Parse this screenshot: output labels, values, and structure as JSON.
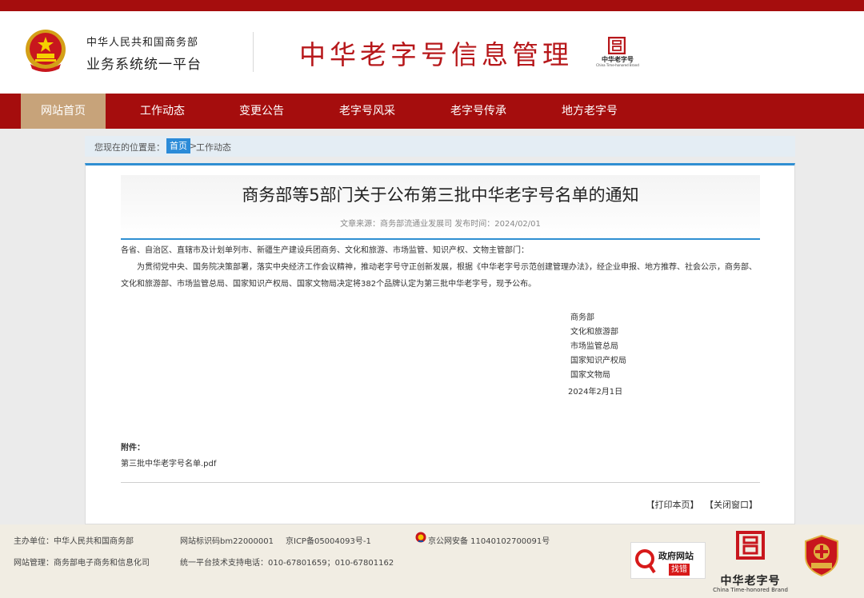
{
  "header": {
    "org_line1": "中华人民共和国商务部",
    "org_line2": "业务系统统一平台",
    "site_title": "中华老字号信息管理",
    "brand_small_cn": "中华老字号",
    "brand_small_en": "China Time-honored Brand"
  },
  "nav": {
    "items": [
      {
        "label": "网站首页",
        "active": true
      },
      {
        "label": "工作动态",
        "active": false
      },
      {
        "label": "变更公告",
        "active": false
      },
      {
        "label": "老字号风采",
        "active": false
      },
      {
        "label": "老字号传承",
        "active": false
      },
      {
        "label": "地方老字号",
        "active": false
      }
    ]
  },
  "breadcrumb": {
    "label": "您现在的位置是：",
    "home": "首页",
    "separator": ">",
    "current": "工作动态"
  },
  "article": {
    "title": "商务部等5部门关于公布第三批中华老字号名单的通知",
    "meta": "文章来源：商务部流通业发展司 发布时间：2024/02/01",
    "salutation": "各省、自治区、直辖市及计划单列市、新疆生产建设兵团商务、文化和旅游、市场监管、知识产权、文物主管部门：",
    "body": "为贯彻党中央、国务院决策部署，落实中央经济工作会议精神，推动老字号守正创新发展，根据《中华老字号示范创建管理办法》，经企业申报、地方推荐、社会公示，商务部、文化和旅游部、市场监管总局、国家知识产权局、国家文物局决定将382个品牌认定为第三批中华老字号，现予公布。",
    "signers": [
      "商务部",
      "文化和旅游部",
      "市场监管总局",
      "国家知识产权局",
      "国家文物局"
    ],
    "date": "2024年2月1日",
    "attachment_label": "附件：",
    "attachment_file": "第三批中华老字号名单.pdf",
    "print_label": "【打印本页】",
    "close_label": "【关闭窗口】"
  },
  "footer": {
    "host": "主办单位：中华人民共和国商务部",
    "site_code": "网站标识码bm22000001",
    "icp": "京ICP备05004093号-1",
    "police": "京公网安备 11040102700091号",
    "manager": "网站管理：商务部电子商务和信息化司",
    "support": "统一平台技术支持电话：010-67801659；010-67801162",
    "gov_badge_line1": "政府网站",
    "gov_badge_line2": "找错",
    "brand_big_cn": "中华老字号",
    "brand_big_en": "China Time-honored Brand",
    "colors": {
      "primary_red": "#a50d0d",
      "active_tab": "#c7a37a",
      "accent_blue": "#2f8fd2",
      "footer_bg": "#f1ede3"
    }
  }
}
